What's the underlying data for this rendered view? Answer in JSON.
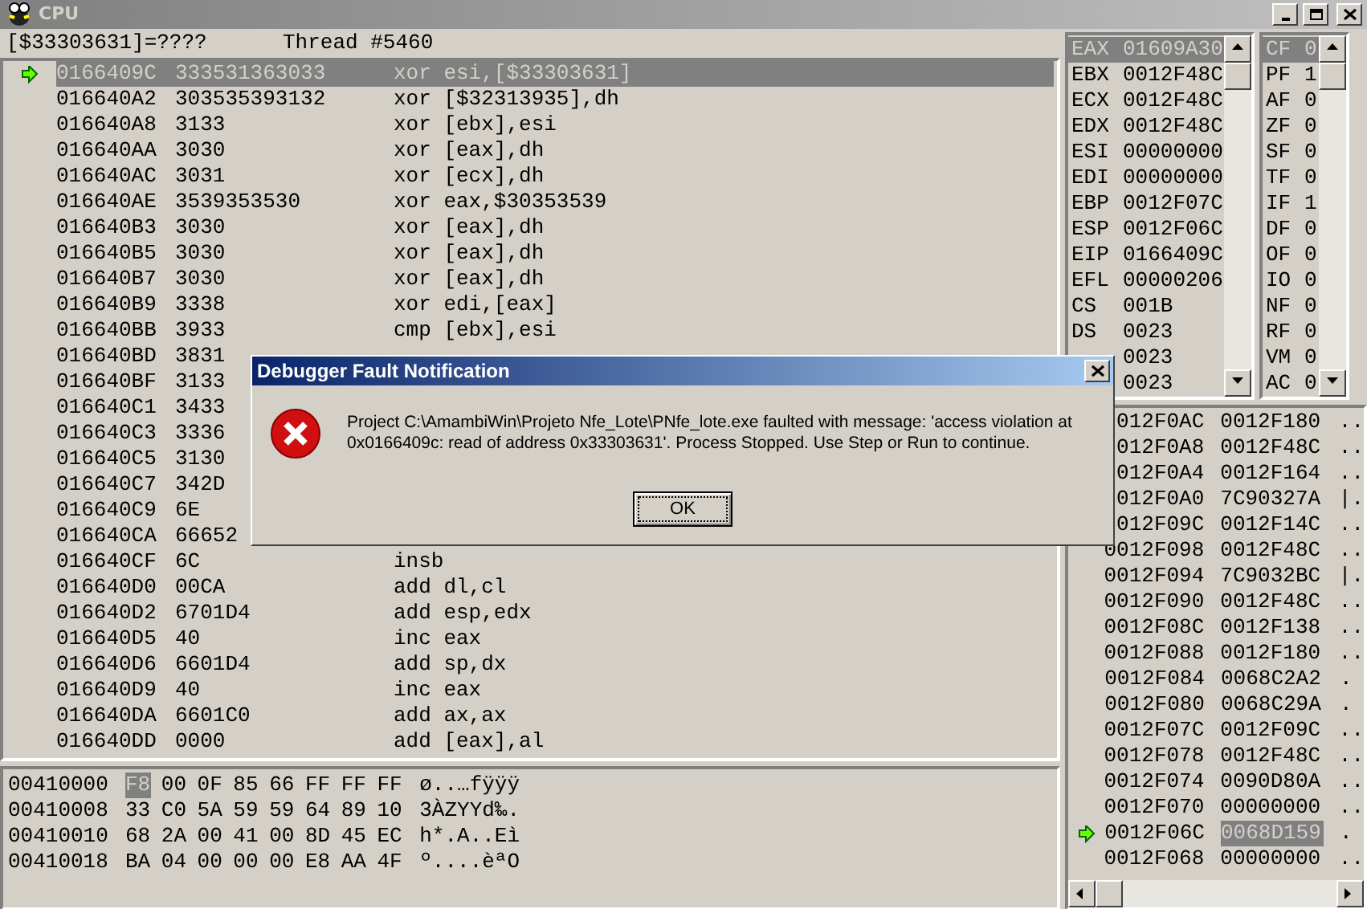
{
  "window": {
    "title": "CPU",
    "buttons": [
      {
        "kind": "minimize"
      },
      {
        "kind": "maximize"
      },
      {
        "kind": "close"
      }
    ]
  },
  "disassembly": {
    "expression": "[$33303631]=????",
    "thread": "Thread #5460",
    "rows": [
      {
        "address": "0166409C",
        "bytes": "333531363033",
        "instruction": "xor esi,[$33303631]",
        "current": true,
        "selected": true
      },
      {
        "address": "016640A2",
        "bytes": "303535393132",
        "instruction": "xor [$32313935],dh",
        "current": false,
        "selected": false
      },
      {
        "address": "016640A8",
        "bytes": "3133",
        "instruction": "xor [ebx],esi",
        "current": false,
        "selected": false
      },
      {
        "address": "016640AA",
        "bytes": "3030",
        "instruction": "xor [eax],dh",
        "current": false,
        "selected": false
      },
      {
        "address": "016640AC",
        "bytes": "3031",
        "instruction": "xor [ecx],dh",
        "current": false,
        "selected": false
      },
      {
        "address": "016640AE",
        "bytes": "3539353530",
        "instruction": "xor eax,$30353539",
        "current": false,
        "selected": false
      },
      {
        "address": "016640B3",
        "bytes": "3030",
        "instruction": "xor [eax],dh",
        "current": false,
        "selected": false
      },
      {
        "address": "016640B5",
        "bytes": "3030",
        "instruction": "xor [eax],dh",
        "current": false,
        "selected": false
      },
      {
        "address": "016640B7",
        "bytes": "3030",
        "instruction": "xor [eax],dh",
        "current": false,
        "selected": false
      },
      {
        "address": "016640B9",
        "bytes": "3338",
        "instruction": "xor edi,[eax]",
        "current": false,
        "selected": false
      },
      {
        "address": "016640BB",
        "bytes": "3933",
        "instruction": "cmp [ebx],esi",
        "current": false,
        "selected": false
      },
      {
        "address": "016640BD",
        "bytes": "3831",
        "current": false,
        "selected": false
      },
      {
        "address": "016640BF",
        "bytes": "3133",
        "current": false,
        "selected": false
      },
      {
        "address": "016640C1",
        "bytes": "3433",
        "current": false,
        "selected": false
      },
      {
        "address": "016640C3",
        "bytes": "3336",
        "current": false,
        "selected": false
      },
      {
        "address": "016640C5",
        "bytes": "3130",
        "current": false,
        "selected": false
      },
      {
        "address": "016640C7",
        "bytes": "342D",
        "current": false,
        "selected": false
      },
      {
        "address": "016640C9",
        "bytes": "6E",
        "current": false,
        "selected": false
      },
      {
        "address": "016640CA",
        "bytes": "66652",
        "current": false,
        "selected": false
      },
      {
        "address": "016640CF",
        "bytes": "6C",
        "instruction": "insb",
        "current": false,
        "selected": false
      },
      {
        "address": "016640D0",
        "bytes": "00CA",
        "instruction": "add dl,cl",
        "current": false,
        "selected": false
      },
      {
        "address": "016640D2",
        "bytes": "6701D4",
        "instruction": "add esp,edx",
        "current": false,
        "selected": false
      },
      {
        "address": "016640D5",
        "bytes": "40",
        "instruction": "inc eax",
        "current": false,
        "selected": false
      },
      {
        "address": "016640D6",
        "bytes": "6601D4",
        "instruction": "add sp,dx",
        "current": false,
        "selected": false
      },
      {
        "address": "016640D9",
        "bytes": "40",
        "instruction": "inc eax",
        "current": false,
        "selected": false
      },
      {
        "address": "016640DA",
        "bytes": "6601C0",
        "instruction": "add ax,ax",
        "current": false,
        "selected": false
      },
      {
        "address": "016640DD",
        "bytes": "0000",
        "instruction": "add [eax],al",
        "current": false,
        "selected": false
      }
    ]
  },
  "memory_dump": {
    "rows": [
      {
        "address": "00410000",
        "bytes": [
          {
            "value": "F8",
            "selected": true
          },
          {
            "value": "00",
            "selected": false
          },
          {
            "value": "0F",
            "selected": false
          },
          {
            "value": "85",
            "selected": false
          },
          {
            "value": "66",
            "selected": false
          },
          {
            "value": "FF",
            "selected": false
          },
          {
            "value": "FF",
            "selected": false
          },
          {
            "value": "FF",
            "selected": false
          }
        ],
        "ascii": "ø..…fÿÿÿ"
      },
      {
        "address": "00410008",
        "bytes": [
          {
            "value": "33",
            "selected": false
          },
          {
            "value": "C0",
            "selected": false
          },
          {
            "value": "5A",
            "selected": false
          },
          {
            "value": "59",
            "selected": false
          },
          {
            "value": "59",
            "selected": false
          },
          {
            "value": "64",
            "selected": false
          },
          {
            "value": "89",
            "selected": false
          },
          {
            "value": "10",
            "selected": false
          }
        ],
        "ascii": "3ÀZYYd‰."
      },
      {
        "address": "00410010",
        "bytes": [
          {
            "value": "68",
            "selected": false
          },
          {
            "value": "2A",
            "selected": false
          },
          {
            "value": "00",
            "selected": false
          },
          {
            "value": "41",
            "selected": false
          },
          {
            "value": "00",
            "selected": false
          },
          {
            "value": "8D",
            "selected": false
          },
          {
            "value": "45",
            "selected": false
          },
          {
            "value": "EC",
            "selected": false
          }
        ],
        "ascii": "h*.A..Eì"
      },
      {
        "address": "00410018",
        "bytes": [
          {
            "value": "BA",
            "selected": false
          },
          {
            "value": "04",
            "selected": false
          },
          {
            "value": "00",
            "selected": false
          },
          {
            "value": "00",
            "selected": false
          },
          {
            "value": "00",
            "selected": false
          },
          {
            "value": "E8",
            "selected": false
          },
          {
            "value": "AA",
            "selected": false
          },
          {
            "value": "4F",
            "selected": false
          }
        ],
        "ascii": "º....èªO"
      }
    ]
  },
  "registers": [
    {
      "name": "EAX",
      "value": "01609A30",
      "selected": true
    },
    {
      "name": "EBX",
      "value": "0012F48C",
      "selected": false
    },
    {
      "name": "ECX",
      "value": "0012F48C",
      "selected": false
    },
    {
      "name": "EDX",
      "value": "0012F48C",
      "selected": false
    },
    {
      "name": "ESI",
      "value": "00000000",
      "selected": false
    },
    {
      "name": "EDI",
      "value": "00000000",
      "selected": false
    },
    {
      "name": "EBP",
      "value": "0012F07C",
      "selected": false
    },
    {
      "name": "ESP",
      "value": "0012F06C",
      "selected": false
    },
    {
      "name": "EIP",
      "value": "0166409C",
      "selected": false
    },
    {
      "name": "EFL",
      "value": "00000206",
      "selected": false
    },
    {
      "name": "CS",
      "value": "001B",
      "selected": false
    },
    {
      "name": "DS",
      "value": "0023",
      "selected": false
    },
    {
      "value": "0023",
      "selected": false
    },
    {
      "value": "0023",
      "selected": false
    }
  ],
  "flags": [
    {
      "name": "CF",
      "value": "0",
      "selected": true
    },
    {
      "name": "PF",
      "value": "1",
      "selected": false
    },
    {
      "name": "AF",
      "value": "0",
      "selected": false
    },
    {
      "name": "ZF",
      "value": "0",
      "selected": false
    },
    {
      "name": "SF",
      "value": "0",
      "selected": false
    },
    {
      "name": "TF",
      "value": "0",
      "selected": false
    },
    {
      "name": "IF",
      "value": "1",
      "selected": false
    },
    {
      "name": "DF",
      "value": "0",
      "selected": false
    },
    {
      "name": "OF",
      "value": "0",
      "selected": false
    },
    {
      "name": "IO",
      "value": "0",
      "selected": false
    },
    {
      "name": "NF",
      "value": "0",
      "selected": false
    },
    {
      "name": "RF",
      "value": "0",
      "selected": false
    },
    {
      "name": "VM",
      "value": "0",
      "selected": false
    },
    {
      "name": "AC",
      "value": "0",
      "selected": false
    }
  ],
  "stack": [
    {
      "address": "012F0AC",
      "value": "0012F180",
      "ascii": "..",
      "current": false,
      "selected": false
    },
    {
      "address": "012F0A8",
      "value": "0012F48C",
      "ascii": "..",
      "current": false,
      "selected": false
    },
    {
      "address": "012F0A4",
      "value": "0012F164",
      "ascii": "..",
      "current": false,
      "selected": false
    },
    {
      "address": "012F0A0",
      "value": "7C90327A",
      "ascii": "|.",
      "current": false,
      "selected": false
    },
    {
      "address": "012F09C",
      "value": "0012F14C",
      "ascii": "..",
      "current": false,
      "selected": false
    },
    {
      "address": "0012F098",
      "value": "0012F48C",
      "ascii": "..",
      "current": false,
      "selected": false
    },
    {
      "address": "0012F094",
      "value": "7C9032BC",
      "ascii": "|.",
      "current": false,
      "selected": false
    },
    {
      "address": "0012F090",
      "value": "0012F48C",
      "ascii": "..",
      "current": false,
      "selected": false
    },
    {
      "address": "0012F08C",
      "value": "0012F138",
      "ascii": "..",
      "current": false,
      "selected": false
    },
    {
      "address": "0012F088",
      "value": "0012F180",
      "ascii": "..",
      "current": false,
      "selected": false
    },
    {
      "address": "0012F084",
      "value": "0068C2A2",
      "ascii": ".",
      "current": false,
      "selected": false
    },
    {
      "address": "0012F080",
      "value": "0068C29A",
      "ascii": ".",
      "current": false,
      "selected": false
    },
    {
      "address": "0012F07C",
      "value": "0012F09C",
      "ascii": "..",
      "current": false,
      "selected": false
    },
    {
      "address": "0012F078",
      "value": "0012F48C",
      "ascii": "..",
      "current": false,
      "selected": false
    },
    {
      "address": "0012F074",
      "value": "0090D80A",
      "ascii": "..",
      "current": false,
      "selected": false
    },
    {
      "address": "0012F070",
      "value": "00000000",
      "ascii": "..",
      "current": false,
      "selected": false
    },
    {
      "address": "0012F06C",
      "value": "0068D159",
      "ascii": ".",
      "current": true,
      "selected": true
    },
    {
      "address": "0012F068",
      "value": "00000000",
      "ascii": "..",
      "current": false,
      "selected": false
    }
  ],
  "dialog": {
    "title": "Debugger Fault Notification",
    "message": "Project C:\\AmambiWin\\Projeto Nfe_Lote\\PNfe_lote.exe faulted with message: 'access violation at 0x0166409c: read of address 0x33303631'. Process Stopped. Use Step or Run to continue.",
    "button": "OK"
  }
}
